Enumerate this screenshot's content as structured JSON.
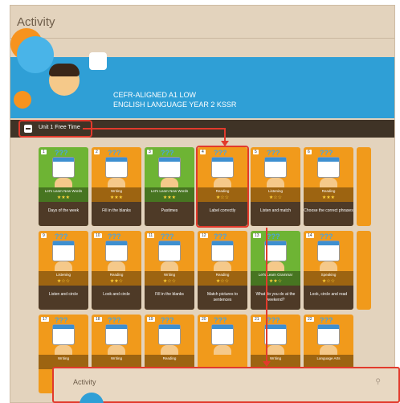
{
  "page": {
    "title": "Activity"
  },
  "banner": {
    "line1": "CEFR-ALIGNED A1 LOW",
    "line2": "ENGLISH LANGUAGE YEAR 2 KSSR"
  },
  "unit": {
    "label": "Unit 1 Free Time"
  },
  "cards_row1": [
    {
      "num": "1",
      "title": "Let's Learn New Words",
      "stars": "★★★",
      "foot": "Days of the week",
      "theme": "green"
    },
    {
      "num": "2",
      "title": "Writing",
      "stars": "★★★",
      "foot": "Fill in the blanks",
      "theme": "orange"
    },
    {
      "num": "3",
      "title": "Let's Learn New Words",
      "stars": "★★★",
      "foot": "Pastimes",
      "theme": "green"
    },
    {
      "num": "4",
      "title": "Reading",
      "stars": "★☆☆",
      "foot": "Label correctly",
      "theme": "orange"
    },
    {
      "num": "5",
      "title": "Listening",
      "stars": "★☆☆",
      "foot": "Listen and match",
      "theme": "orange"
    },
    {
      "num": "6",
      "title": "Reading",
      "stars": "★★★",
      "foot": "Choose the correct phrases",
      "theme": "orange"
    }
  ],
  "cards_row2": [
    {
      "num": "9",
      "title": "Listening",
      "stars": "★☆☆",
      "foot": "Listen and circle",
      "theme": "orange"
    },
    {
      "num": "10",
      "title": "Reading",
      "stars": "★★☆",
      "foot": "Look and circle",
      "theme": "orange"
    },
    {
      "num": "11",
      "title": "Writing",
      "stars": "★☆☆",
      "foot": "Fill in the blanks",
      "theme": "orange"
    },
    {
      "num": "12",
      "title": "Reading",
      "stars": "★☆☆",
      "foot": "Match pictures to sentences",
      "theme": "orange"
    },
    {
      "num": "13",
      "title": "Let's Learn Grammar",
      "stars": "★★☆",
      "foot": "What do you do at the weekend?",
      "theme": "green"
    },
    {
      "num": "14",
      "title": "Speaking",
      "stars": "★☆☆",
      "foot": "Look, circle and read",
      "theme": "orange"
    }
  ],
  "cards_row3": [
    {
      "num": "17",
      "title": "Writing",
      "stars": "",
      "foot": "",
      "theme": "orange"
    },
    {
      "num": "18",
      "title": "Writing",
      "stars": "",
      "foot": "",
      "theme": "orange"
    },
    {
      "num": "19",
      "title": "Reading",
      "stars": "",
      "foot": "",
      "theme": "orange"
    },
    {
      "num": "20",
      "title": "",
      "stars": "",
      "foot": "",
      "theme": "orange"
    },
    {
      "num": "21",
      "title": "Writing",
      "stars": "",
      "foot": "",
      "theme": "orange"
    },
    {
      "num": "22",
      "title": "Language Arts",
      "stars": "",
      "foot": "",
      "theme": "orange"
    }
  ],
  "popup": {
    "title": "Activity"
  },
  "colors": {
    "highlight": "#e23a2c",
    "banner_blue": "#2f9fd6",
    "card_orange": "#f19a1b",
    "card_green": "#6eb434"
  }
}
